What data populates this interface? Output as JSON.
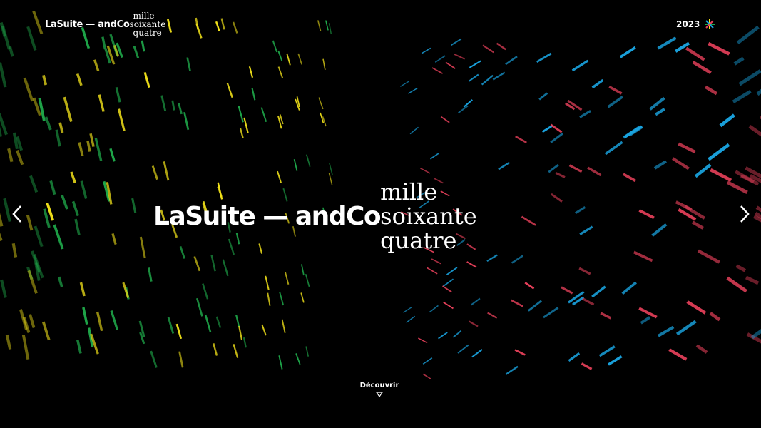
{
  "header": {
    "logo_sans": "LaSuite — andCo",
    "logo_serif": [
      "mille",
      "soixante",
      "quatre"
    ],
    "year": "2023"
  },
  "hero": {
    "title_sans": "LaSuite — andCo",
    "title_serif": [
      "mille",
      "soixante",
      "quatre"
    ]
  },
  "cta": {
    "label": "Découvrir"
  },
  "icons": {
    "prev": "chevron-left-icon",
    "next": "chevron-right-icon",
    "down": "triangle-down-icon",
    "star": "asterisk-icon"
  },
  "colors": {
    "background": "#000000",
    "text": "#ffffff",
    "yellow": "#f2e21a",
    "green": "#1fa84a",
    "blue": "#1aa4e0",
    "red": "#e8415b"
  }
}
